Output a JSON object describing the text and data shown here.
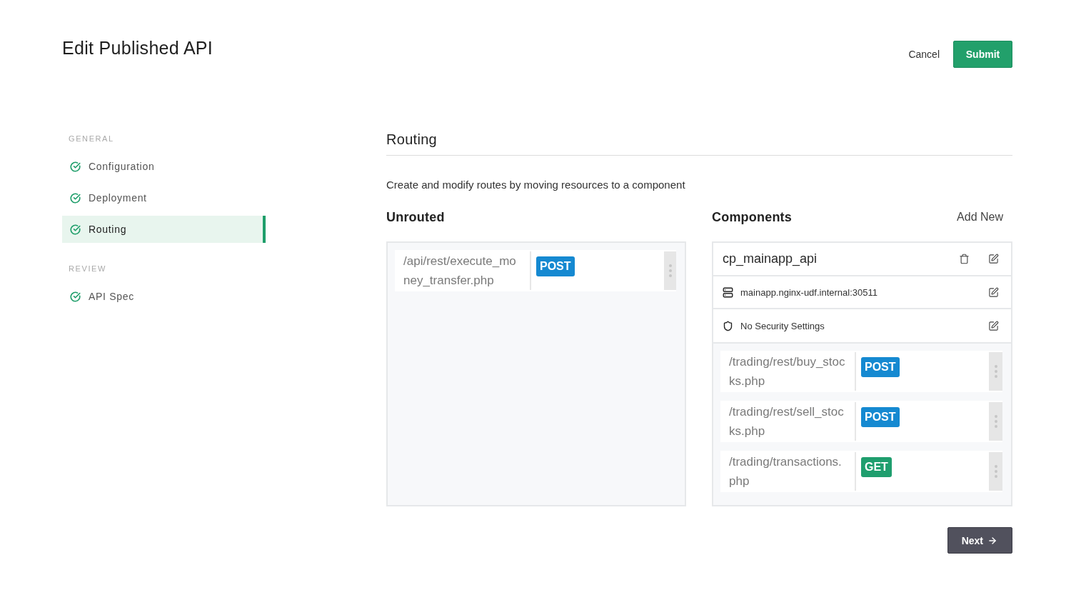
{
  "header": {
    "title": "Edit Published API",
    "actions": [
      {
        "label": "Cancel",
        "kind": "link"
      },
      {
        "label": "Submit",
        "kind": "primary"
      }
    ]
  },
  "sidebar": {
    "sections": [
      {
        "heading": "GENERAL",
        "items": [
          {
            "label": "Configuration",
            "completed": true,
            "selected": false
          },
          {
            "label": "Deployment",
            "completed": true,
            "selected": false
          },
          {
            "label": "Routing",
            "completed": true,
            "selected": true
          }
        ]
      },
      {
        "heading": "REVIEW",
        "items": [
          {
            "label": "API Spec",
            "completed": true,
            "selected": false
          }
        ]
      }
    ]
  },
  "main": {
    "title": "Routing",
    "description": "Create and modify routes by moving resources to a component",
    "unrouted": {
      "heading": "Unrouted",
      "routes": [
        {
          "path": "/api/rest/execute_money_transfer.php",
          "method": "POST",
          "color": "#1589d1"
        }
      ]
    },
    "components": {
      "heading": "Components",
      "add_label": "Add New",
      "items": [
        {
          "name": "cp_mainapp_api",
          "upstream": "mainapp.nginx-udf.internal:30511",
          "security": "No Security Settings",
          "routes": [
            {
              "path": "/trading/rest/buy_stocks.php",
              "method": "POST",
              "color": "#1589d1"
            },
            {
              "path": "/trading/rest/sell_stocks.php",
              "method": "POST",
              "color": "#1589d1"
            },
            {
              "path": "/trading/transactions.php",
              "method": "GET",
              "color": "#1f9e6e"
            }
          ]
        }
      ]
    }
  },
  "footer": {
    "next_label": "Next"
  }
}
